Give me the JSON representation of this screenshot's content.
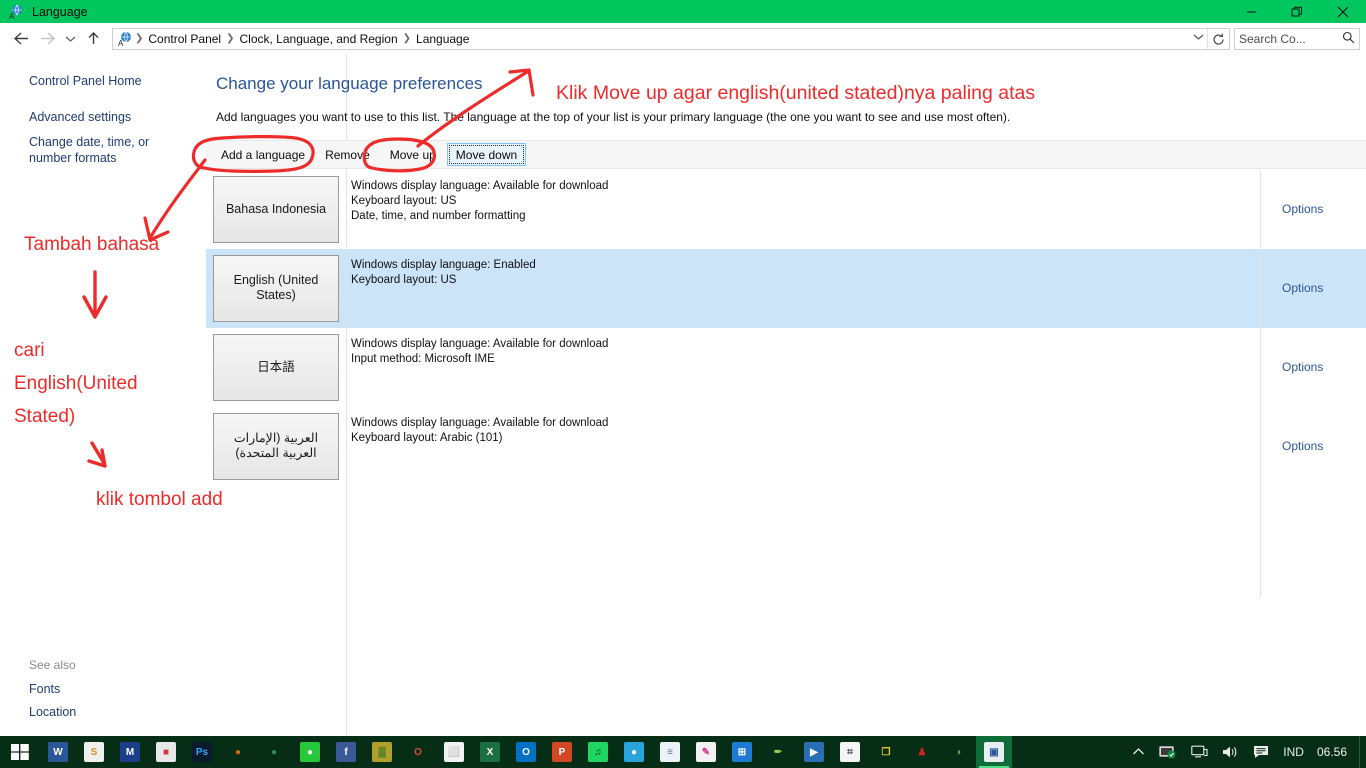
{
  "window": {
    "title": "Language",
    "title_icon": "language-globe-icon",
    "buttons": {
      "minimize": "—",
      "maximize": "❐",
      "close": "✕"
    }
  },
  "navbar": {
    "back_icon": "←",
    "forward_icon": "→",
    "recent_icon": "⌄",
    "up_icon": "↑",
    "breadcrumb": [
      "Control Panel",
      "Clock, Language, and Region",
      "Language"
    ],
    "separator": "❯",
    "dropdown_icon": "⌄",
    "refresh_icon": "↻",
    "search": {
      "value": "Search Co...",
      "placeholder": "Search Control Panel",
      "icon": "🔍"
    }
  },
  "sidebar": {
    "home": "Control Panel Home",
    "advanced": "Advanced settings",
    "change_formats": "Change date, time, or number formats",
    "see_also_label": "See also",
    "fonts": "Fonts",
    "location": "Location"
  },
  "main": {
    "title": "Change your language preferences",
    "description": "Add languages you want to use to this list. The language at the top of your list is your primary language (the one you want to see and use most often).",
    "toolbar": [
      {
        "label": "Add a language",
        "state": "normal"
      },
      {
        "label": "Remove",
        "state": "normal"
      },
      {
        "label": "Move up",
        "state": "normal"
      },
      {
        "label": "Move down",
        "state": "focused"
      }
    ],
    "options_label": "Options",
    "languages": [
      {
        "name": "Bahasa Indonesia",
        "rtl": false,
        "selected": false,
        "details": [
          "Windows display language: Available for download",
          "Keyboard layout: US",
          "Date, time, and number formatting"
        ]
      },
      {
        "name": "English (United States)",
        "rtl": false,
        "selected": true,
        "details": [
          "Windows display language: Enabled",
          "Keyboard layout: US"
        ]
      },
      {
        "name": "日本語",
        "rtl": false,
        "selected": false,
        "details": [
          "Windows display language: Available for download",
          "Input method: Microsoft IME"
        ]
      },
      {
        "name": "العربية (الإمارات العربية المتحدة)",
        "rtl": true,
        "selected": false,
        "details": [
          "Windows display language: Available for download",
          "Keyboard layout: Arabic (101)"
        ]
      }
    ]
  },
  "annotations": {
    "color": "#ee2b2b",
    "move_up_note": "Klik Move up agar english(united stated)nya paling atas",
    "add_note": "Tambah bahasa",
    "find_note_line1": "cari",
    "find_note_line2": "English(United",
    "find_note_line3": "Stated)",
    "click_add_note": "klik tombol add"
  },
  "taskbar": {
    "background": "#062e16",
    "start_icon": "windows-start-icon",
    "apps": [
      {
        "name": "word-icon",
        "glyph": "W",
        "bg": "#2b579a",
        "fg": "#ffffff"
      },
      {
        "name": "sb-mail-icon",
        "glyph": "S",
        "bg": "#f0f0f0",
        "fg": "#e08a17"
      },
      {
        "name": "m-app-icon",
        "glyph": "M",
        "bg": "#1b3f8b",
        "fg": "#ffffff"
      },
      {
        "name": "photo-viewer-icon",
        "glyph": "■",
        "bg": "#e8e8e8",
        "fg": "#d23b3b"
      },
      {
        "name": "photoshop-icon",
        "glyph": "Ps",
        "bg": "#0b1b2b",
        "fg": "#31a8ff"
      },
      {
        "name": "firefox-icon",
        "glyph": "●",
        "bg": "#062e16",
        "fg": "#e66000"
      },
      {
        "name": "idm-icon",
        "glyph": "●",
        "bg": "#062e16",
        "fg": "#2e8b57"
      },
      {
        "name": "line-icon",
        "glyph": "●",
        "bg": "#26c939",
        "fg": "#ffffff"
      },
      {
        "name": "facebook-icon",
        "glyph": "f",
        "bg": "#3b5998",
        "fg": "#ffffff"
      },
      {
        "name": "mosaic-app-icon",
        "glyph": "▓",
        "bg": "#b3a02a",
        "fg": "#4e7d2e"
      },
      {
        "name": "opera-icon",
        "glyph": "O",
        "bg": "#062e16",
        "fg": "#d94a3d"
      },
      {
        "name": "store-icon",
        "glyph": "⬜",
        "bg": "#f2f2f2",
        "fg": "#4a4a4a"
      },
      {
        "name": "excel-icon",
        "glyph": "X",
        "bg": "#1d6f42",
        "fg": "#ffffff"
      },
      {
        "name": "outlook-icon",
        "glyph": "O",
        "bg": "#0072c6",
        "fg": "#ffffff"
      },
      {
        "name": "powerpoint-icon",
        "glyph": "P",
        "bg": "#d24726",
        "fg": "#ffffff"
      },
      {
        "name": "spotify-icon",
        "glyph": "♫",
        "bg": "#1ed760",
        "fg": "#062e16"
      },
      {
        "name": "chat-icon",
        "glyph": "●",
        "bg": "#2aa3dd",
        "fg": "#ffffff"
      },
      {
        "name": "notepad-icon",
        "glyph": "≡",
        "bg": "#eef3f7",
        "fg": "#5a7a96"
      },
      {
        "name": "paint-icon",
        "glyph": "✎",
        "bg": "#f2f2f2",
        "fg": "#d23b8f"
      },
      {
        "name": "windows-store-icon",
        "glyph": "⊞",
        "bg": "#1f7ad4",
        "fg": "#ffffff"
      },
      {
        "name": "leaf-app-icon",
        "glyph": "✒",
        "bg": "#062e16",
        "fg": "#8fd94a"
      },
      {
        "name": "media-player-icon",
        "glyph": "▶",
        "bg": "#2a6fb5",
        "fg": "#ffffff"
      },
      {
        "name": "calculator-icon",
        "glyph": "⌗",
        "bg": "#f5f5f5",
        "fg": "#555555"
      },
      {
        "name": "folders-icon",
        "glyph": "❐",
        "bg": "#062e16",
        "fg": "#e8c53a"
      },
      {
        "name": "redbottle-icon",
        "glyph": "♟",
        "bg": "#062e16",
        "fg": "#cf2222"
      },
      {
        "name": "nero-icon",
        "glyph": "◑",
        "bg": "#062e16",
        "fg": "#4ab54a"
      },
      {
        "name": "control-panel-language-icon",
        "glyph": "▣",
        "bg": "#e9eef5",
        "fg": "#2a5699",
        "active": true
      }
    ],
    "tray": {
      "overflow_icon": "∧",
      "antivirus_icon": "▣",
      "network_icon": "⌸",
      "volume_icon": "🔊",
      "action_center_icon": "🗪",
      "language_indicator": "IND",
      "clock": "06.56"
    }
  }
}
